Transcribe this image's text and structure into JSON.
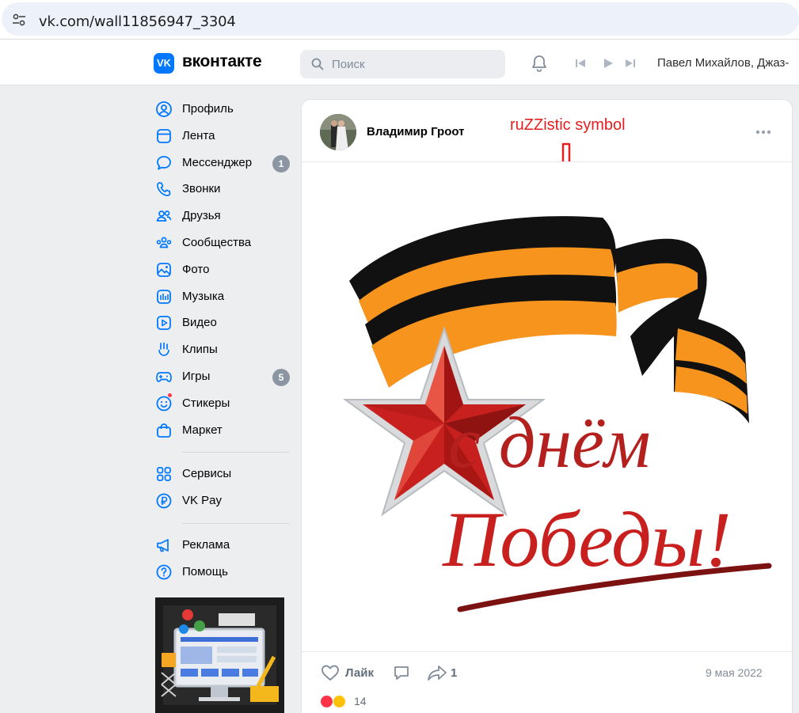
{
  "browser": {
    "url": "vk.com/wall11856947_3304"
  },
  "header": {
    "logo_letters": "VK",
    "wordmark": "вконтакте",
    "search_placeholder": "Поиск",
    "player_text": "Павел Михайлов, Джаз-"
  },
  "sidebar": {
    "items": [
      {
        "label": "Профиль",
        "icon": "profile-icon"
      },
      {
        "label": "Лента",
        "icon": "feed-icon"
      },
      {
        "label": "Мессенджер",
        "icon": "messenger-icon",
        "badge": "1"
      },
      {
        "label": "Звонки",
        "icon": "phone-icon"
      },
      {
        "label": "Друзья",
        "icon": "friends-icon"
      },
      {
        "label": "Сообщества",
        "icon": "communities-icon"
      },
      {
        "label": "Фото",
        "icon": "photo-icon"
      },
      {
        "label": "Музыка",
        "icon": "music-icon"
      },
      {
        "label": "Видео",
        "icon": "video-icon"
      },
      {
        "label": "Клипы",
        "icon": "clips-icon"
      },
      {
        "label": "Игры",
        "icon": "games-icon",
        "badge": "5"
      },
      {
        "label": "Стикеры",
        "icon": "stickers-icon"
      },
      {
        "label": "Маркет",
        "icon": "market-icon"
      }
    ],
    "items2": [
      {
        "label": "Сервисы",
        "icon": "services-icon"
      },
      {
        "label": "VK Pay",
        "icon": "vkpay-icon"
      }
    ],
    "items3": [
      {
        "label": "Реклама",
        "icon": "ads-icon"
      },
      {
        "label": "Помощь",
        "icon": "help-icon"
      }
    ]
  },
  "post": {
    "author": "Владимир Гроот",
    "annotation": "ruZZistic symbol",
    "image_text_line1": "с днём",
    "image_text_line2": "Победы!",
    "like_label": "Лайк",
    "share_count": "1",
    "date": "9 мая 2022",
    "reactions_count": "14"
  },
  "colors": {
    "accent": "#0077ff",
    "ribbon_orange": "#f7941d",
    "ribbon_black": "#111111",
    "star_red": "#c8201e",
    "annotation_red": "#e61e1e"
  }
}
